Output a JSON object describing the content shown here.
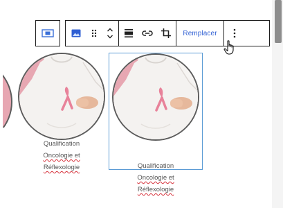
{
  "toolbar": {
    "parent_icon": "image-parent-icon",
    "buttons": {
      "image": "image-icon",
      "drag": "drag-handle-icon",
      "move": "move-up-down-icon",
      "align": "align-icon",
      "link": "link-icon",
      "crop": "crop-icon",
      "more": "more-options-icon"
    },
    "replace_label": "Remplacer"
  },
  "gallery": {
    "items": [
      {
        "line1": "Qualification",
        "line2": "Oncologie et",
        "line3": "Réflexologie"
      },
      {
        "line1": "Qualification",
        "line2": "Oncologie et",
        "line3": "Réflexologie"
      }
    ]
  },
  "colors": {
    "accent": "#2f5fd3",
    "selection": "#5b9bd5",
    "spellcheck": "#d6303a",
    "ribbon": "#e8829a",
    "shirt": "#f4f2f0",
    "backdrop": "#e7a7b2"
  }
}
